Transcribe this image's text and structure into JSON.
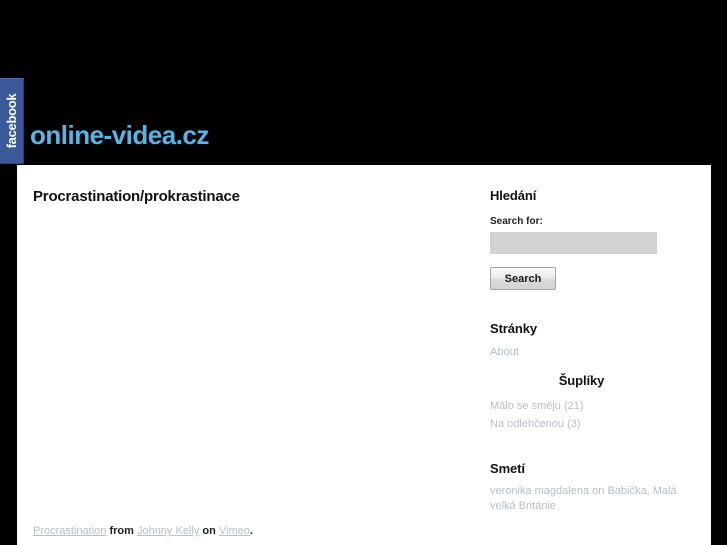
{
  "browser": {
    "fb_tab_label": "facebook",
    "fb_tab_color": "#3b5998"
  },
  "header": {
    "site_title": "online-videa.cz",
    "title_color": "#4fb8e8",
    "background": "#000000"
  },
  "content": {
    "post_title": "Procrastination/prokrastinace",
    "credit": {
      "video_link": "Procrastination",
      "from_text": "from",
      "author_link": "Johnny Kelly",
      "on_text": "on",
      "platform_link": "Vimeo",
      "period": "."
    }
  },
  "sidebar": {
    "search": {
      "heading": "Hledání",
      "label": "Search for:",
      "value": "",
      "placeholder": "",
      "button_label": "Search"
    },
    "pages": {
      "heading": "Stránky",
      "items": [
        {
          "label": "About"
        }
      ]
    },
    "categories": {
      "heading": "Šuplíky",
      "items": [
        {
          "label": "Málo se směju",
          "count": "(21)"
        },
        {
          "label": "Na odlehčenou",
          "count": "(3)"
        }
      ]
    },
    "comments": {
      "heading": "Smetí",
      "items": [
        {
          "author": "veronika magdalena",
          "on": "on",
          "post": "Babička, Malá velká Británie"
        }
      ]
    }
  }
}
